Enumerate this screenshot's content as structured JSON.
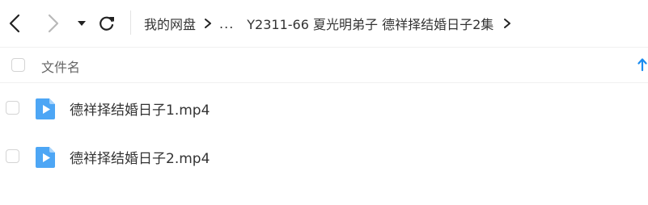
{
  "toolbar": {
    "back_icon": "chevron-left-icon",
    "forward_icon": "chevron-right-icon",
    "dropdown_icon": "caret-down-icon",
    "refresh_icon": "refresh-icon"
  },
  "breadcrumb": {
    "root": "我的网盘",
    "ellipsis": "...",
    "current": "Y2311-66 夏光明弟子 德祥择结婚日子2集"
  },
  "list_header": {
    "name_column": "文件名",
    "sort_icon": "arrow-up-icon"
  },
  "files": [
    {
      "name": "德祥择结婚日子1.mp4",
      "icon": "video-file-icon"
    },
    {
      "name": "德祥择结婚日子2.mp4",
      "icon": "video-file-icon"
    }
  ],
  "colors": {
    "accent": "#1a8cf0",
    "video_icon": "#4da6f5",
    "text": "#333333",
    "muted_text": "#666666"
  }
}
